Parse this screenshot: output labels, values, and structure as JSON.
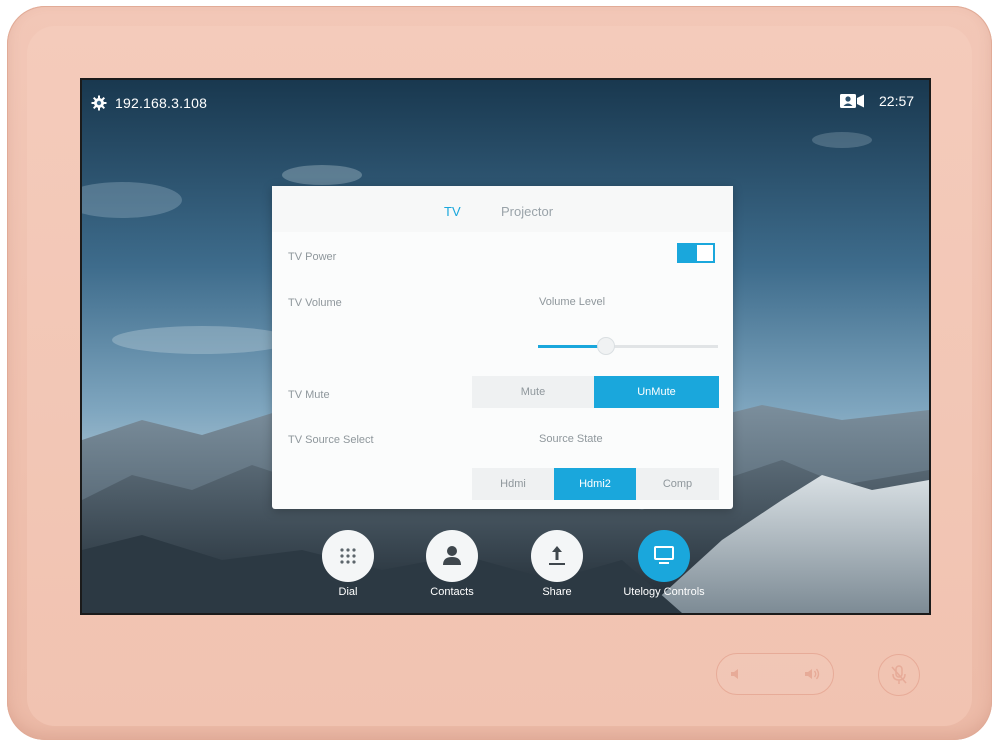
{
  "status_bar": {
    "ip_address": "192.168.3.108",
    "time": "22:57",
    "settings_icon": "gear-icon",
    "camera_icon": "camera-icon"
  },
  "panel": {
    "tabs": [
      {
        "label": "TV",
        "active": true
      },
      {
        "label": "Projector",
        "active": false
      }
    ],
    "tv_power": {
      "label": "TV Power",
      "on": true
    },
    "tv_volume": {
      "label": "TV Volume",
      "sublabel": "Volume Level",
      "level_percent": 38
    },
    "tv_mute": {
      "label": "TV Mute",
      "options": [
        "Mute",
        "UnMute"
      ],
      "selected": "UnMute"
    },
    "tv_source": {
      "label": "TV Source Select",
      "sublabel": "Source State",
      "options": [
        "Hdmi",
        "Hdmi2",
        "Comp"
      ],
      "selected": "Hdmi2"
    }
  },
  "dock": {
    "items": [
      {
        "label": "Dial",
        "icon": "dialpad-icon",
        "active": false
      },
      {
        "label": "Contacts",
        "icon": "person-icon",
        "active": false
      },
      {
        "label": "Share",
        "icon": "upload-icon",
        "active": false
      },
      {
        "label": "Utelogy Controls",
        "icon": "monitor-icon",
        "active": true
      }
    ]
  },
  "colors": {
    "accent": "#1aa7dc",
    "bezel": "#f0c3b2"
  }
}
